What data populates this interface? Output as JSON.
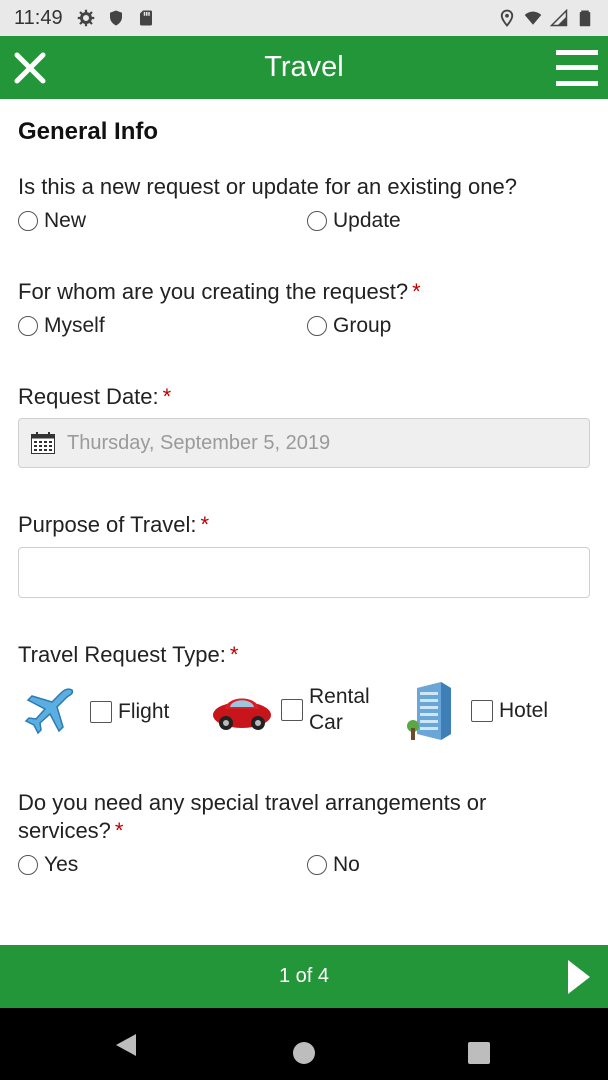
{
  "status_bar": {
    "time": "11:49"
  },
  "header": {
    "title": "Travel"
  },
  "section": {
    "title": "General Info"
  },
  "q_request": {
    "label": "Is this a new request or update for an existing one?",
    "options": [
      "New",
      "Update"
    ]
  },
  "q_whom": {
    "label": "For whom are you creating the request?",
    "required": "*",
    "options": [
      "Myself",
      "Group"
    ]
  },
  "q_date": {
    "label": "Request Date:",
    "required": "*",
    "value": "Thursday, September 5, 2019"
  },
  "q_purpose": {
    "label": "Purpose of Travel:",
    "required": "*",
    "value": ""
  },
  "q_type": {
    "label": "Travel Request Type:",
    "required": "*",
    "options": [
      "Flight",
      "Rental Car",
      "Hotel"
    ]
  },
  "q_special": {
    "label_line1": "Do you need any special travel arrangements or",
    "label_line2": "services?",
    "required": "*",
    "options": [
      "Yes",
      "No"
    ]
  },
  "footer": {
    "page_indicator": "1 of 4"
  },
  "colors": {
    "brand_green": "#24963a",
    "required_red": "#b00000"
  }
}
